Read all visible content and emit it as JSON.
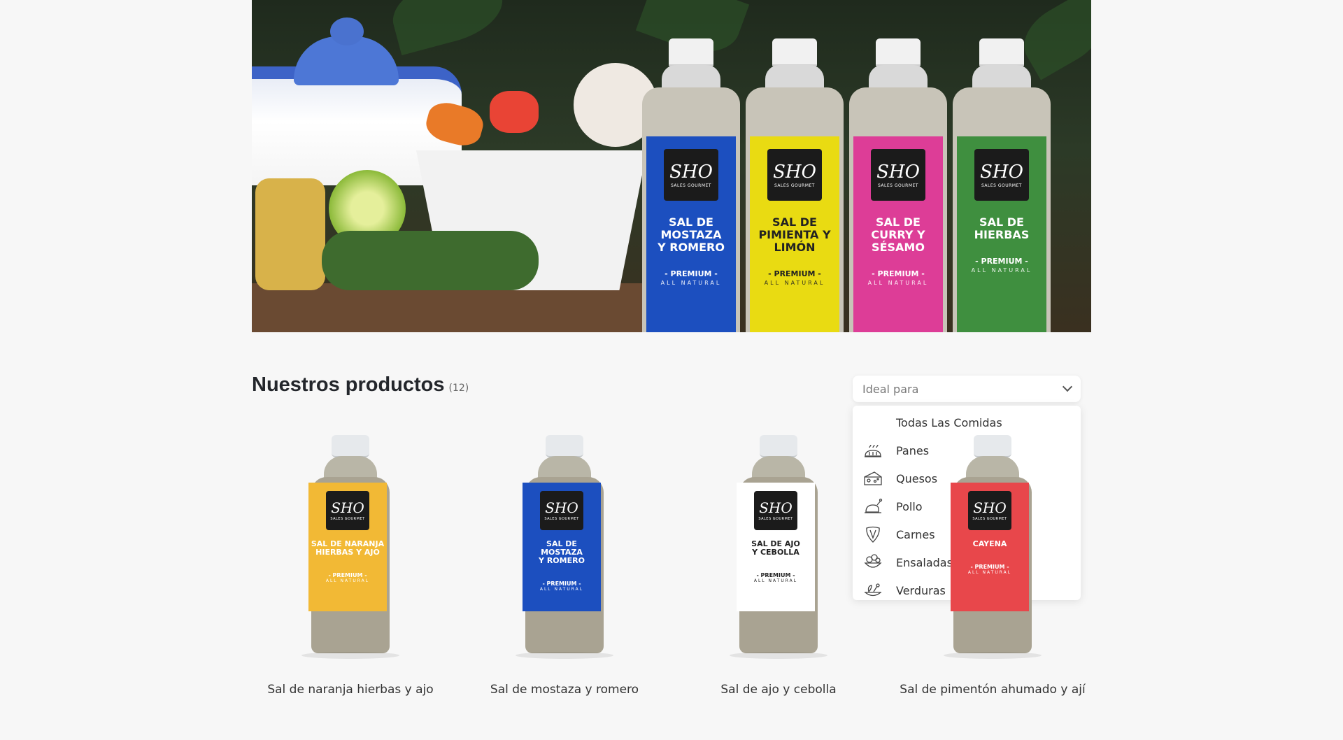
{
  "hero": {
    "bottles": [
      {
        "name": "SAL DE\nMOSTAZA\nY ROMERO",
        "color": "#1c4fbf"
      },
      {
        "name": "SAL DE\nPIMIENTA Y\nLIMÓN",
        "color": "#e9db12"
      },
      {
        "name": "SAL DE\nCURRY Y\nSÉSAMO",
        "color": "#dd3d97"
      },
      {
        "name": "SAL DE\nHIERBAS",
        "color": "#3f8f3f"
      }
    ],
    "brand_mark": "SHO",
    "brand_sub": "SALES GOURMET",
    "premium": "- PREMIUM -",
    "natural": "ALL NATURAL"
  },
  "section": {
    "title": "Nuestros productos",
    "count": "(12)"
  },
  "filter": {
    "placeholder": "Ideal para",
    "options": [
      {
        "label": "Todas Las Comidas",
        "icon": ""
      },
      {
        "label": "Panes",
        "icon": "bread-icon"
      },
      {
        "label": "Quesos",
        "icon": "cheese-icon"
      },
      {
        "label": "Pollo",
        "icon": "chicken-icon"
      },
      {
        "label": "Carnes",
        "icon": "steak-icon"
      },
      {
        "label": "Ensaladas",
        "icon": "salad-icon"
      },
      {
        "label": "Verduras",
        "icon": "vegetables-icon"
      }
    ]
  },
  "products": [
    {
      "name": "Sal de naranja hierbas y ajo",
      "label": "SAL DE NARANJA\nHIERBAS Y AJO",
      "color": "#f2b935"
    },
    {
      "name": "Sal de mostaza y romero",
      "label": "SAL DE\nMOSTAZA\nY ROMERO",
      "color": "#1c4fbf"
    },
    {
      "name": "Sal de ajo y cebolla",
      "label": "SAL DE AJO\nY CEBOLLA",
      "color": "#ffffff"
    },
    {
      "name": "Sal de pimentón ahumado y ají",
      "label": "CAYENA",
      "color": "#e8474b"
    }
  ]
}
